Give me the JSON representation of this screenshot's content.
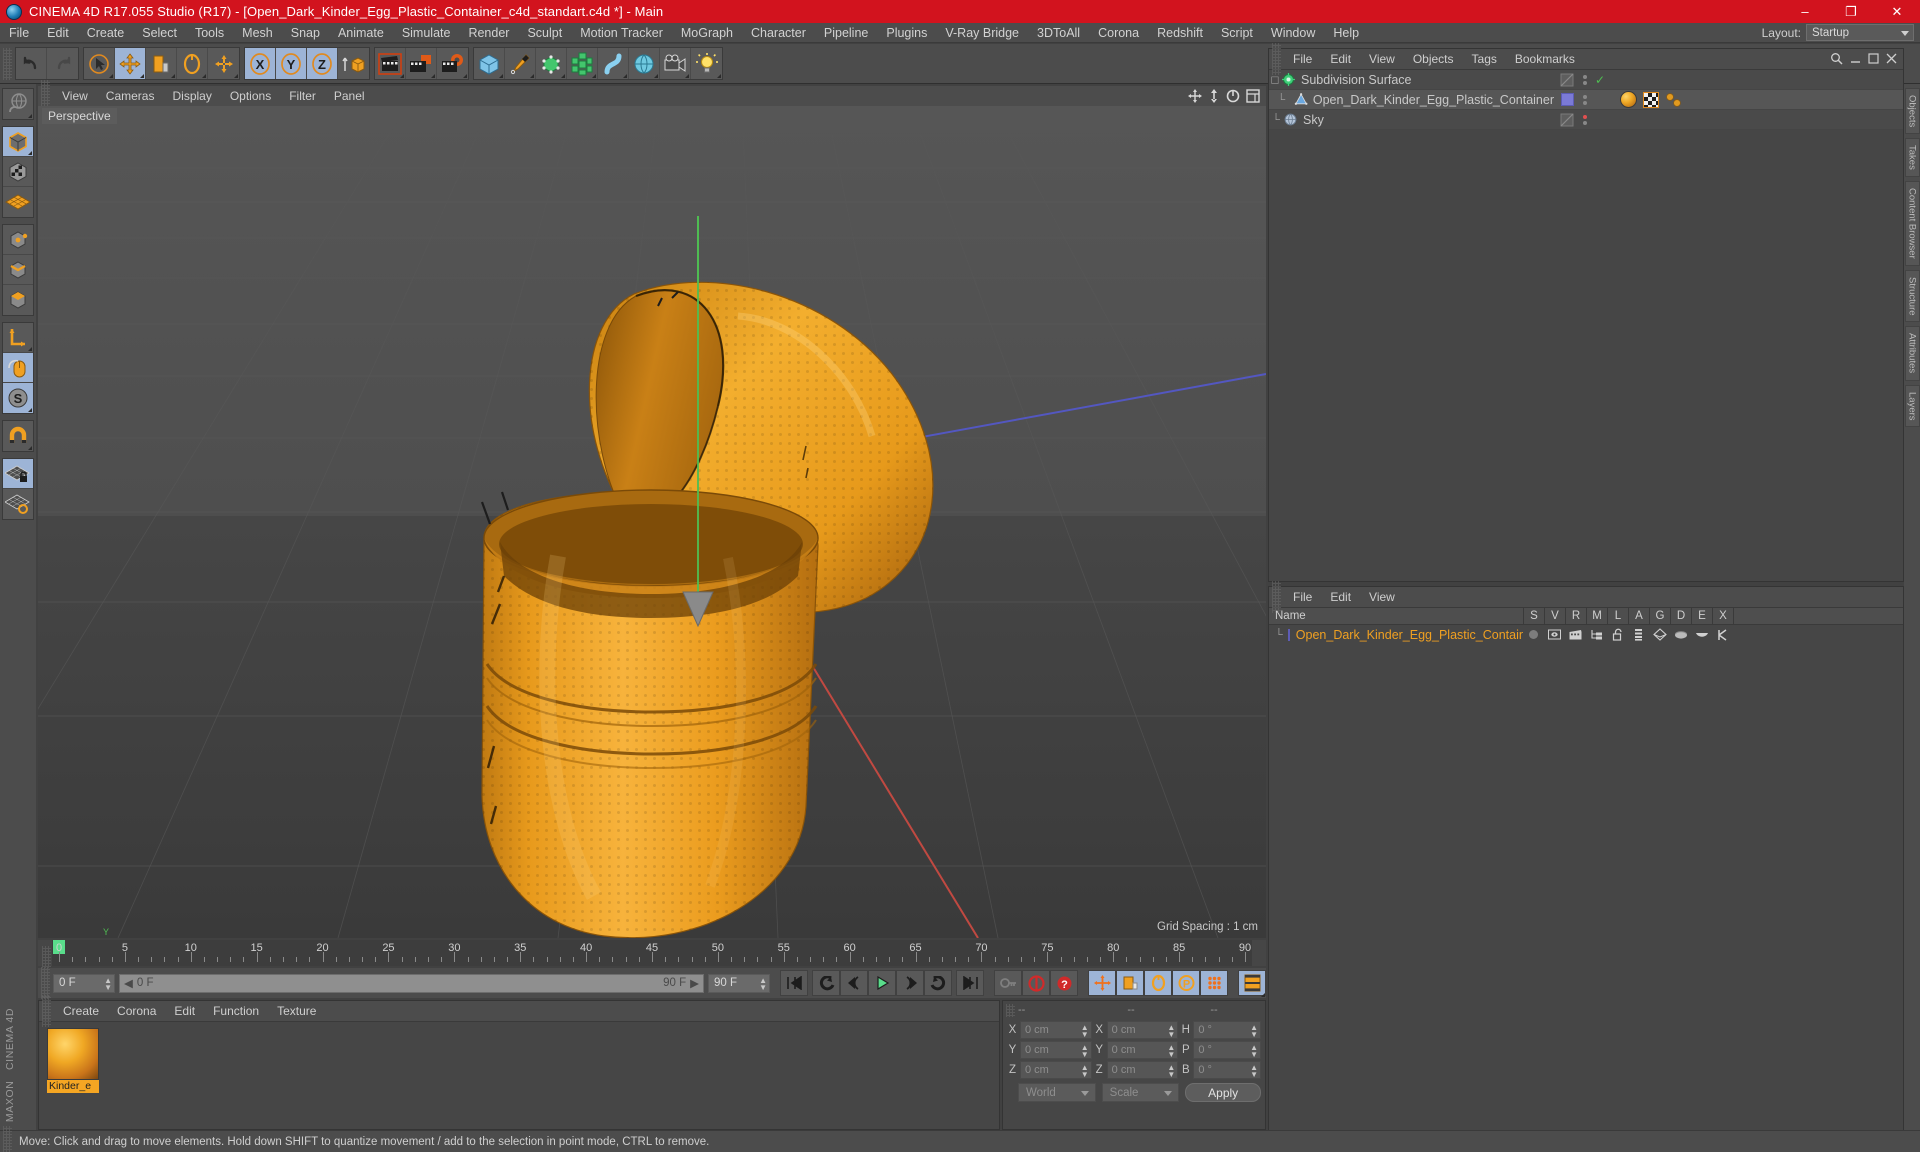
{
  "window": {
    "title": "CINEMA 4D R17.055 Studio (R17) - [Open_Dark_Kinder_Egg_Plastic_Container_c4d_standart.c4d *] - Main",
    "logo_icon": "cinema4d-logo-icon",
    "minimize": "–",
    "maximize": "❐",
    "close": "✕",
    "titlebar_color": "#d2131e"
  },
  "menubar": {
    "items": [
      "File",
      "Edit",
      "Create",
      "Select",
      "Tools",
      "Mesh",
      "Snap",
      "Animate",
      "Simulate",
      "Render",
      "Sculpt",
      "Motion Tracker",
      "MoGraph",
      "Character",
      "Pipeline",
      "Plugins",
      "V-Ray Bridge",
      "3DToAll",
      "Corona",
      "Redshift",
      "Script",
      "Window",
      "Help"
    ],
    "layout_label": "Layout:",
    "layout_value": "Startup"
  },
  "toolbar": {
    "groups": [
      {
        "name": "undo-redo",
        "buttons": [
          {
            "name": "undo-button",
            "icon": "undo-arrow-icon",
            "state": "normal"
          },
          {
            "name": "redo-button",
            "icon": "redo-arrow-icon",
            "state": "disabled"
          }
        ]
      },
      {
        "name": "transform-tools",
        "buttons": [
          {
            "name": "select-tool-button",
            "icon": "live-selection-cursor-icon",
            "state": "normal"
          },
          {
            "name": "move-tool-button",
            "icon": "move-cross-icon",
            "state": "selected"
          },
          {
            "name": "scale-tool-button",
            "icon": "scale-box-icon",
            "state": "normal"
          },
          {
            "name": "rotate-tool-button",
            "icon": "rotate-circle-icon",
            "state": "normal"
          },
          {
            "name": "universal-tool-button",
            "icon": "universal-cross-icon",
            "state": "normal"
          }
        ]
      },
      {
        "name": "axis-locks",
        "buttons": [
          {
            "name": "lock-x-axis-button",
            "icon": "x-axis-icon",
            "state": "selected",
            "label": "X"
          },
          {
            "name": "lock-y-axis-button",
            "icon": "y-axis-icon",
            "state": "selected",
            "label": "Y"
          },
          {
            "name": "lock-z-axis-button",
            "icon": "z-axis-icon",
            "state": "selected",
            "label": "Z"
          },
          {
            "name": "world-object-coordinates-button",
            "icon": "world-axis-icon",
            "state": "normal"
          }
        ]
      },
      {
        "name": "render-tools",
        "buttons": [
          {
            "name": "render-view-button",
            "icon": "render-view-clapper-icon",
            "state": "normal"
          },
          {
            "name": "render-to-picture-viewer-button",
            "icon": "render-picture-viewer-icon",
            "state": "normal"
          },
          {
            "name": "render-settings-button",
            "icon": "render-settings-gear-icon",
            "state": "normal"
          }
        ]
      },
      {
        "name": "object-creation",
        "buttons": [
          {
            "name": "add-cube-button",
            "icon": "cube-primitive-icon",
            "state": "normal"
          },
          {
            "name": "add-spline-button",
            "icon": "pen-spline-icon",
            "state": "normal"
          },
          {
            "name": "add-generator-button",
            "icon": "subdivision-generator-icon",
            "state": "normal"
          },
          {
            "name": "add-array-button",
            "icon": "array-modeling-icon",
            "state": "normal"
          },
          {
            "name": "add-deformer-button",
            "icon": "bend-deformer-icon",
            "state": "normal"
          },
          {
            "name": "add-environment-button",
            "icon": "environment-scene-icon",
            "state": "normal"
          },
          {
            "name": "add-camera-button",
            "icon": "camera-icon",
            "state": "normal"
          },
          {
            "name": "add-light-button",
            "icon": "light-bulb-icon",
            "state": "normal"
          }
        ]
      }
    ]
  },
  "left_toolbar": {
    "groups": [
      {
        "name": "undo-view-group",
        "buttons": [
          {
            "name": "undo-view-button",
            "icon": "undo-view-globe-icon",
            "state": "disabled"
          }
        ]
      },
      {
        "name": "mode-group",
        "buttons": [
          {
            "name": "model-mode-button",
            "icon": "model-cube-icon",
            "state": "selected"
          },
          {
            "name": "texture-mode-button",
            "icon": "texture-checker-cube-icon",
            "state": "normal"
          },
          {
            "name": "workplane-mode-button",
            "icon": "workplane-grid-icon",
            "state": "normal"
          }
        ]
      },
      {
        "name": "component-group",
        "buttons": [
          {
            "name": "points-mode-button",
            "icon": "points-cube-icon",
            "state": "normal"
          },
          {
            "name": "edges-mode-button",
            "icon": "edges-cube-icon",
            "state": "normal"
          },
          {
            "name": "polygons-mode-button",
            "icon": "polygons-cube-icon",
            "state": "normal"
          }
        ]
      },
      {
        "name": "axis-group",
        "buttons": [
          {
            "name": "enable-axis-button",
            "icon": "axis-modification-icon",
            "state": "normal"
          },
          {
            "name": "viewport-solo-button",
            "icon": "mouse-pointer-icon",
            "state": "selected"
          },
          {
            "name": "soft-selection-button",
            "icon": "soft-selection-s-icon",
            "state": "selected"
          }
        ]
      },
      {
        "name": "snap-group",
        "buttons": [
          {
            "name": "enable-snap-button",
            "icon": "magnet-snap-icon",
            "state": "normal"
          }
        ]
      },
      {
        "name": "grid-group",
        "buttons": [
          {
            "name": "lock-workplane-button",
            "icon": "grid-lock-icon",
            "state": "selected"
          },
          {
            "name": "workplane-ortho-button",
            "icon": "grid-ortho-icon",
            "state": "normal"
          }
        ]
      }
    ],
    "brand_line1": "MAXON",
    "brand_line2": "CINEMA 4D"
  },
  "viewport": {
    "menu_items": [
      "View",
      "Cameras",
      "Display",
      "Options",
      "Filter",
      "Panel"
    ],
    "label": "Perspective",
    "grid_spacing": "Grid Spacing : 1 cm",
    "header_icons": [
      "viewport-move-icon",
      "viewport-scale-icon",
      "viewport-rotate-icon",
      "viewport-layout-icon"
    ],
    "model_color": "#f0a021",
    "axis_colors": {
      "x": "#cc3b33",
      "y": "#4fbf52",
      "z": "#3b4fcc"
    },
    "scene_object": "Open_Dark_Kinder_Egg_Plastic_Container"
  },
  "object_manager": {
    "menu_items": [
      "File",
      "Edit",
      "View",
      "Objects",
      "Tags",
      "Bookmarks"
    ],
    "rows": [
      {
        "name": "Subdivision Surface",
        "icon": "subdivision-surface-icon",
        "indent": 0,
        "selected": false,
        "visibility_dots": "visibility-toggle-icon",
        "enabled_mark": "✓",
        "tags": []
      },
      {
        "name": "Open_Dark_Kinder_Egg_Plastic_Container",
        "icon": "polygon-object-icon",
        "indent": 1,
        "selected": true,
        "layer_color": "#7b7ad6",
        "tags": [
          "material-tag-icon",
          "texture-checker-tag-icon",
          "phong-tag-icon"
        ]
      },
      {
        "name": "Sky",
        "icon": "sky-object-icon",
        "indent": 0,
        "selected": false,
        "dot_color": "#e05050",
        "tags": []
      }
    ]
  },
  "layer_manager": {
    "menu_items": [
      "File",
      "Edit",
      "View"
    ],
    "columns": [
      "S",
      "V",
      "R",
      "M",
      "L",
      "A",
      "G",
      "D",
      "E",
      "X"
    ],
    "name_header": "Name",
    "rows": [
      {
        "name": "Open_Dark_Kinder_Egg_Plastic_Container",
        "swatch": "#7b7ad6",
        "name_color": "#f0a021",
        "icons": [
          "solo-dot-icon",
          "view-eye-icon",
          "render-clapper-icon",
          "manager-tree-icon",
          "lock-open-icon",
          "animation-bars-icon",
          "generator-icon",
          "deformer-icon",
          "expression-icon",
          "xref-icon"
        ]
      }
    ]
  },
  "right_dock": {
    "tabs": [
      "Objects",
      "Takes",
      "Content Browser",
      "Structure",
      "Attributes",
      "Layers"
    ]
  },
  "timeline": {
    "start_frame_marker": 0,
    "ticks": [
      0,
      5,
      10,
      15,
      20,
      25,
      30,
      35,
      40,
      45,
      50,
      55,
      60,
      65,
      70,
      75,
      80,
      85,
      90
    ],
    "current_frame_field": "0 F",
    "range_start": "0 F",
    "range_end": "90 F",
    "end_frame_field": "90 F",
    "preview_min": "0 F",
    "playhead_frame": 0
  },
  "animation_toolbar": {
    "transport": [
      {
        "name": "go-to-start-button",
        "icon": "skip-start-icon"
      },
      {
        "name": "previous-key-button",
        "icon": "prev-key-icon"
      },
      {
        "name": "step-back-button",
        "icon": "step-back-icon"
      },
      {
        "name": "play-button",
        "icon": "play-triangle-icon"
      },
      {
        "name": "step-forward-button",
        "icon": "step-forward-icon"
      },
      {
        "name": "next-key-button",
        "icon": "next-key-icon"
      },
      {
        "name": "go-to-end-button",
        "icon": "skip-end-icon"
      }
    ],
    "record": [
      {
        "name": "autokey-button",
        "icon": "autokey-key-icon",
        "state": "disabled"
      },
      {
        "name": "record-active-objects-button",
        "icon": "record-circle-icon",
        "state": "normal"
      },
      {
        "name": "keyframe-selection-button",
        "icon": "question-key-icon",
        "state": "normal"
      }
    ],
    "keyframe_filters": [
      {
        "name": "position-key-button",
        "icon": "position-cross-icon",
        "state": "selected"
      },
      {
        "name": "scale-key-button",
        "icon": "scale-key-icon",
        "state": "selected"
      },
      {
        "name": "rotation-key-button",
        "icon": "rotation-key-icon",
        "state": "selected"
      },
      {
        "name": "parameter-key-button",
        "icon": "parameter-p-icon",
        "state": "selected"
      },
      {
        "name": "point-level-animation-button",
        "icon": "pla-dots-icon",
        "state": "selected"
      }
    ],
    "timeline_toggle": {
      "name": "timeline-toggle-button",
      "icon": "timeline-film-icon",
      "state": "selected"
    }
  },
  "material_manager": {
    "menu_items": [
      "Create",
      "Corona",
      "Edit",
      "Function",
      "Texture"
    ],
    "materials": [
      {
        "name": "Kinder_e",
        "preview": "orange-glossy-sphere-icon",
        "selected": true
      }
    ]
  },
  "coordinate_manager": {
    "headers": [
      "--",
      "--",
      "--"
    ],
    "position": {
      "label_x": "X",
      "label_y": "Y",
      "label_z": "Z",
      "x": "0 cm",
      "y": "0 cm",
      "z": "0 cm"
    },
    "size": {
      "label_x": "X",
      "label_y": "Y",
      "label_z": "Z",
      "x": "0 cm",
      "y": "0 cm",
      "z": "0 cm"
    },
    "rotation": {
      "label_h": "H",
      "label_p": "P",
      "label_b": "B",
      "h": "0 °",
      "p": "0 °",
      "b": "0 °"
    },
    "system_select": "World",
    "mode_select": "Scale",
    "apply_label": "Apply"
  },
  "statusbar": {
    "message": "Move: Click and drag to move elements. Hold down SHIFT to quantize movement / add to the selection in point mode, CTRL to remove."
  }
}
